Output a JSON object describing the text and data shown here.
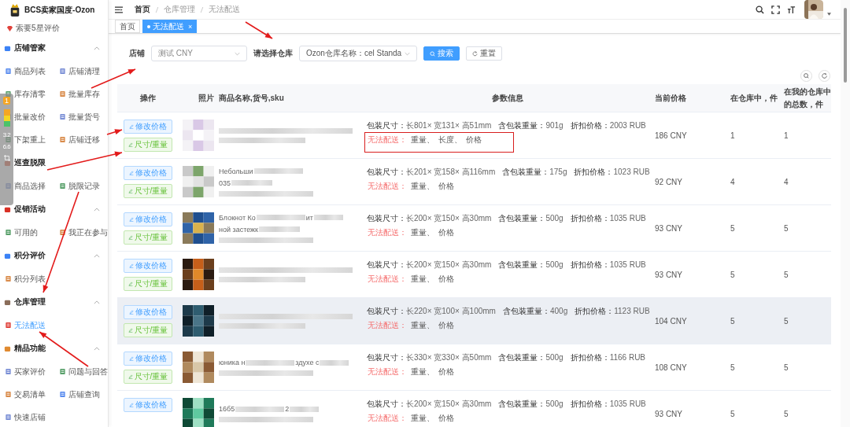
{
  "sidebar": {
    "brand": "BCS卖家国度-Ozon",
    "top_items": [
      {
        "label": "索要5星评价",
        "selected": false
      }
    ],
    "groups": [
      {
        "title": "店铺管家",
        "expanded": true,
        "items": [
          {
            "label": "商品列表",
            "selected": false
          },
          {
            "label": "店铺清理",
            "selected": false
          },
          {
            "label": "库存清零",
            "selected": false
          },
          {
            "label": "批量库存",
            "selected": false
          },
          {
            "label": "批量改价",
            "selected": false
          },
          {
            "label": "批量货号",
            "selected": false
          },
          {
            "label": "下架重上",
            "selected": false
          },
          {
            "label": "店铺迁移",
            "selected": false
          }
        ]
      },
      {
        "title": "巡查脱限",
        "items": [
          {
            "label": "商品选择",
            "selected": false
          },
          {
            "label": "脱限记录",
            "selected": false
          }
        ]
      },
      {
        "title": "促销活动",
        "expanded": true,
        "items": [
          {
            "label": "可用的",
            "selected": false
          },
          {
            "label": "我正在参与",
            "selected": false
          }
        ]
      },
      {
        "title": "积分评价",
        "expanded": true,
        "items": [
          {
            "label": "积分列表",
            "selected": false
          }
        ]
      },
      {
        "title": "仓库管理",
        "expanded": true,
        "items": [
          {
            "label": "无法配送",
            "selected": true
          }
        ]
      },
      {
        "title": "精品功能",
        "expanded": true,
        "items": [
          {
            "label": "买家评价",
            "selected": false
          },
          {
            "label": "问题与回答",
            "selected": false
          },
          {
            "label": "交易清单",
            "selected": false
          },
          {
            "label": "店铺查询",
            "selected": false
          },
          {
            "label": "快速店铺",
            "selected": false
          }
        ]
      }
    ]
  },
  "floating_widget": {
    "badge": "1",
    "upload": "3.2",
    "download": "6.6"
  },
  "breadcrumb": [
    "首页",
    "仓库管理",
    "无法配送"
  ],
  "tabs": [
    {
      "label": "首页",
      "selected": false,
      "closable": false
    },
    {
      "label": "无法配送",
      "selected": true,
      "closable": true
    }
  ],
  "close_glyph": "×",
  "filters": {
    "shop_label": "店铺",
    "shop_value": "测试 CNY",
    "warehouse_label": "请选择仓库",
    "warehouse_value": "Ozon仓库名称：cel Standa",
    "search_button": "搜索",
    "reset_button": "重置"
  },
  "table": {
    "columns": [
      "操作",
      "照片",
      "商品名称,货号,sku",
      "参数信息",
      "当前价格",
      "在仓库中，件",
      "在我的仓库中的总数，件"
    ],
    "rows": [
      {
        "buttons": [
          "修改价格",
          "尺寸/重量"
        ],
        "params": [
          {
            "label": "包装尺寸：",
            "value": "长801× 宽131× 高51mm"
          },
          {
            "label": "含包装重量：",
            "value": "901g"
          },
          {
            "label": "折扣价格：",
            "value": "2003 RUB"
          }
        ],
        "unshippable": {
          "label": "无法配送：",
          "reasons": [
            "重量、",
            "长度、",
            "价格"
          ],
          "highlighted": true
        },
        "price": "186 CNY",
        "in_warehouse": "1",
        "total": "1",
        "hovered": false
      },
      {
        "name_lines": [
          [
            "Небольши"
          ],
          [
            "035"
          ]
        ],
        "buttons": [
          "修改价格",
          "尺寸/重量"
        ],
        "params": [
          {
            "label": "包装尺寸：",
            "value": "长201× 宽158× 高116mm"
          },
          {
            "label": "含包装重量：",
            "value": "175g"
          },
          {
            "label": "折扣价格：",
            "value": "1023 RUB"
          }
        ],
        "unshippable": {
          "label": "无法配送：",
          "reasons": [
            "重量、",
            "价格"
          ],
          "highlighted": false
        },
        "price": "92 CNY",
        "in_warehouse": "4",
        "total": "4",
        "hovered": false
      },
      {
        "name_lines": [
          [
            "Блокнот Ко",
            "ит"
          ],
          [
            "ной застежк"
          ]
        ],
        "buttons": [
          "修改价格",
          "尺寸/重量"
        ],
        "params": [
          {
            "label": "包装尺寸：",
            "value": "长200× 宽150× 高30mm"
          },
          {
            "label": "含包装重量：",
            "value": "500g"
          },
          {
            "label": "折扣价格：",
            "value": "1035 RUB"
          }
        ],
        "unshippable": {
          "label": "无法配送：",
          "reasons": [
            "重量、",
            "价格"
          ],
          "highlighted": false
        },
        "price": "93 CNY",
        "in_warehouse": "5",
        "total": "5",
        "hovered": false
      },
      {
        "buttons": [
          "修改价格",
          "尺寸/重量"
        ],
        "params": [
          {
            "label": "包装尺寸：",
            "value": "长200× 宽150× 高30mm"
          },
          {
            "label": "含包装重量：",
            "value": "500g"
          },
          {
            "label": "折扣价格：",
            "value": "1035 RUB"
          }
        ],
        "unshippable": {
          "label": "无法配送：",
          "reasons": [
            "重量、",
            "价格"
          ],
          "highlighted": false
        },
        "price": "93 CNY",
        "in_warehouse": "5",
        "total": "5",
        "hovered": false
      },
      {
        "buttons": [
          "修改价格",
          "尺寸/重量"
        ],
        "params": [
          {
            "label": "包装尺寸：",
            "value": "长220× 宽100× 高100mm"
          },
          {
            "label": "含包装重量：",
            "value": "400g"
          },
          {
            "label": "折扣价格：",
            "value": "1123 RUB"
          }
        ],
        "unshippable": {
          "label": "无法配送：",
          "reasons": [
            "重量、",
            "价格"
          ],
          "highlighted": false
        },
        "price": "104 CNY",
        "in_warehouse": "5",
        "total": "5",
        "hovered": true
      },
      {
        "name_lines": [
          [
            "юника н",
            "здухе с"
          ]
        ],
        "buttons": [
          "修改价格",
          "尺寸/重量"
        ],
        "params": [
          {
            "label": "包装尺寸：",
            "value": "长330× 宽330× 高50mm"
          },
          {
            "label": "含包装重量：",
            "value": "500g"
          },
          {
            "label": "折扣价格：",
            "value": "1166 RUB"
          }
        ],
        "unshippable": {
          "label": "无法配送：",
          "reasons": [
            "重量、",
            "价格"
          ],
          "highlighted": false
        },
        "price": "108 CNY",
        "in_warehouse": "5",
        "total": "5",
        "hovered": false
      },
      {
        "name_lines": [
          [
            "16б5",
            "2"
          ]
        ],
        "buttons": [
          "修改价格"
        ],
        "params": [
          {
            "label": "包装尺寸：",
            "value": "长200× 宽150× 高30mm"
          },
          {
            "label": "含包装重量：",
            "value": "500g"
          },
          {
            "label": "折扣价格：",
            "value": "1035 RUB"
          }
        ],
        "unshippable": {
          "label": "无法配送：",
          "reasons": [
            "重量、",
            "价格"
          ],
          "highlighted": false
        },
        "price": "93 CNY",
        "in_warehouse": "5",
        "total": "5",
        "hovered": false
      }
    ]
  }
}
